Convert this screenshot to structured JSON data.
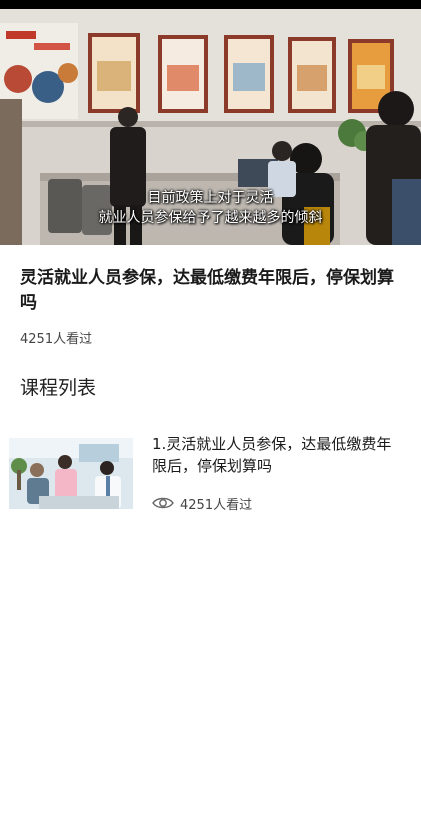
{
  "video": {
    "subtitle_line1": "目前政策上对于灵活",
    "subtitle_line2": "就业人员参保给予了越来越多的倾斜"
  },
  "course": {
    "title": "灵活就业人员参保，达最低缴费年限后，停保划算吗",
    "views": "4251人看过"
  },
  "section": {
    "heading": "课程列表"
  },
  "lessons": [
    {
      "title": "1.灵活就业人员参保，达最低缴费年限后，停保划算吗",
      "views": "4251人看过",
      "icon": "eye-icon"
    }
  ],
  "colors": {
    "subtitle_text": "#ffffff",
    "status_bar": "#000000",
    "meta_text": "#444444"
  }
}
